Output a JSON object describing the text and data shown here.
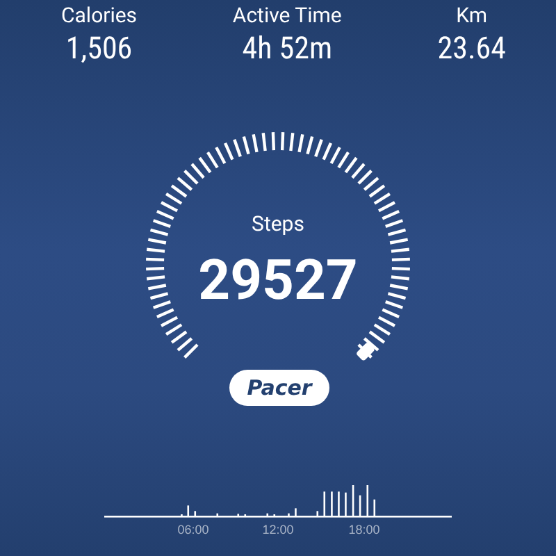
{
  "stats": [
    {
      "label": "Calories",
      "value": "1,506"
    },
    {
      "label": "Active Time",
      "value": "4h 52m"
    },
    {
      "label": "Km",
      "value": "23.64"
    }
  ],
  "gauge": {
    "label": "Steps",
    "value": "29527"
  },
  "brand": "Pacer",
  "activity": {
    "x_labels": [
      "06:00",
      "12:00",
      "18:00"
    ]
  }
}
